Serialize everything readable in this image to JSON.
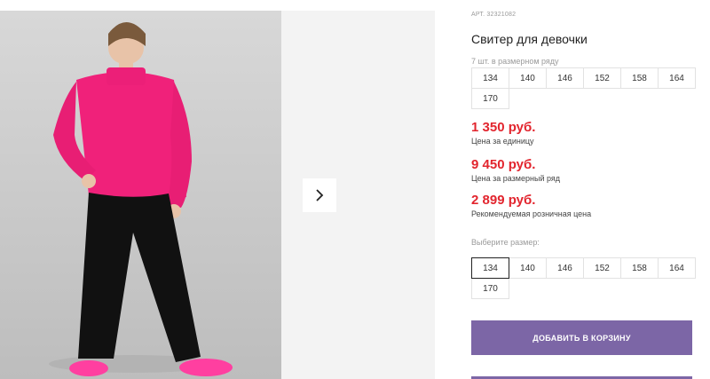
{
  "product": {
    "sku_label": "АРТ. 32321082",
    "title": "Свитер для девочки",
    "range_caption": "7 шт. в размерном ряду",
    "range_sizes": [
      "134",
      "140",
      "146",
      "152",
      "158",
      "164",
      "170"
    ]
  },
  "prices": {
    "unit_price": "1 350 руб.",
    "unit_note": "Цена за единицу",
    "range_price": "9 450 руб.",
    "range_note": "Цена за размерный ряд",
    "retail_price": "2 899 руб.",
    "retail_note": "Рекомендуемая розничная цена",
    "price_color": "#e2252e"
  },
  "size_select": {
    "caption": "Выберите размер:",
    "sizes": [
      "134",
      "140",
      "146",
      "152",
      "158",
      "164",
      "170"
    ],
    "selected": "134"
  },
  "actions": {
    "add_to_cart_label": "ДОБАВИТЬ В КОРЗИНУ",
    "button_color": "#7c66a6"
  },
  "gallery": {
    "next_icon": "chevron-right-icon",
    "photo_subject": "girl in pink sweater and black wide trousers"
  }
}
